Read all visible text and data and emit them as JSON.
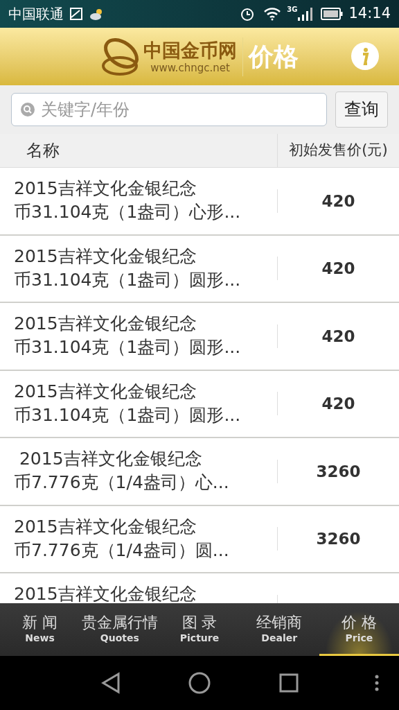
{
  "status_bar": {
    "carrier": "中国联通",
    "network": "3G",
    "time": "14:14"
  },
  "header": {
    "logo_name": "中国金币网",
    "logo_url": "www.chngc.net",
    "title": "价格"
  },
  "search": {
    "placeholder": "关键字/年份",
    "button": "查询"
  },
  "table": {
    "columns": [
      "名称",
      "初始发售价(元)"
    ],
    "rows": [
      {
        "name": [
          "2015吉祥文化金银纪念",
          "币31.104克（1盎司）心形..."
        ],
        "price": "420"
      },
      {
        "name": [
          "2015吉祥文化金银纪念",
          "币31.104克（1盎司）圆形..."
        ],
        "price": "420"
      },
      {
        "name": [
          "2015吉祥文化金银纪念",
          "币31.104克（1盎司）圆形..."
        ],
        "price": "420"
      },
      {
        "name": [
          "2015吉祥文化金银纪念",
          "币31.104克（1盎司）圆形..."
        ],
        "price": "420"
      },
      {
        "name": [
          " 2015吉祥文化金银纪念",
          "币7.776克（1/4盎司）心..."
        ],
        "price": "3260"
      },
      {
        "name": [
          "2015吉祥文化金银纪念",
          "币7.776克（1/4盎司）圆..."
        ],
        "price": "3260"
      },
      {
        "name": [
          "2015吉祥文化金银纪念"
        ]
      }
    ]
  },
  "tabs": [
    {
      "label": "新 闻",
      "sub": "News",
      "selected": false
    },
    {
      "label": "贵金属行情",
      "sub": "Quotes",
      "selected": false
    },
    {
      "label": "图 录",
      "sub": "Picture",
      "selected": false
    },
    {
      "label": "经销商",
      "sub": "Dealer",
      "selected": false
    },
    {
      "label": "价 格",
      "sub": "Price",
      "selected": true
    }
  ]
}
